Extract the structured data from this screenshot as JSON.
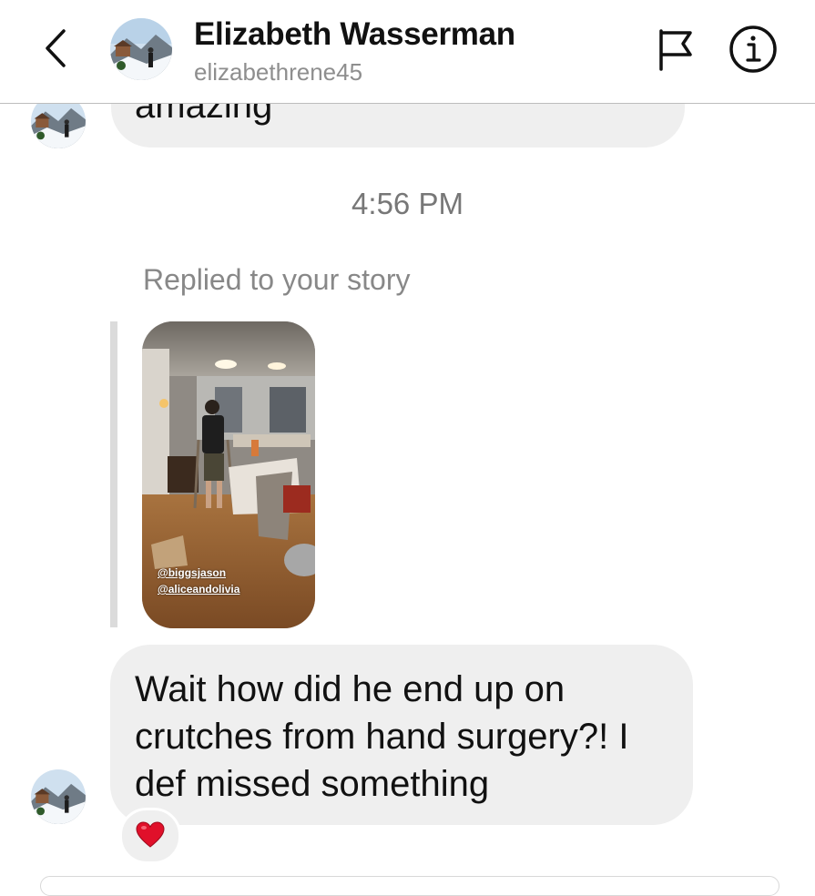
{
  "header": {
    "name": "Elizabeth Wasserman",
    "username": "elizabethrene45",
    "back_icon": "chevron-left-icon",
    "flag_icon": "flag-icon",
    "info_icon": "info-icon"
  },
  "messages": {
    "prev_text": "amazing",
    "timestamp": "4:56 PM",
    "reply_label": "Replied to your story",
    "story_tags": [
      "@biggsjason",
      "@aliceandolivia"
    ],
    "main_text": "Wait how did he end up on crutches from hand surgery?! I def missed something",
    "reaction": "❤️"
  },
  "colors": {
    "bubble": "#efefef",
    "secondary_text": "#8e8e8e",
    "heart": "#e0102a"
  }
}
